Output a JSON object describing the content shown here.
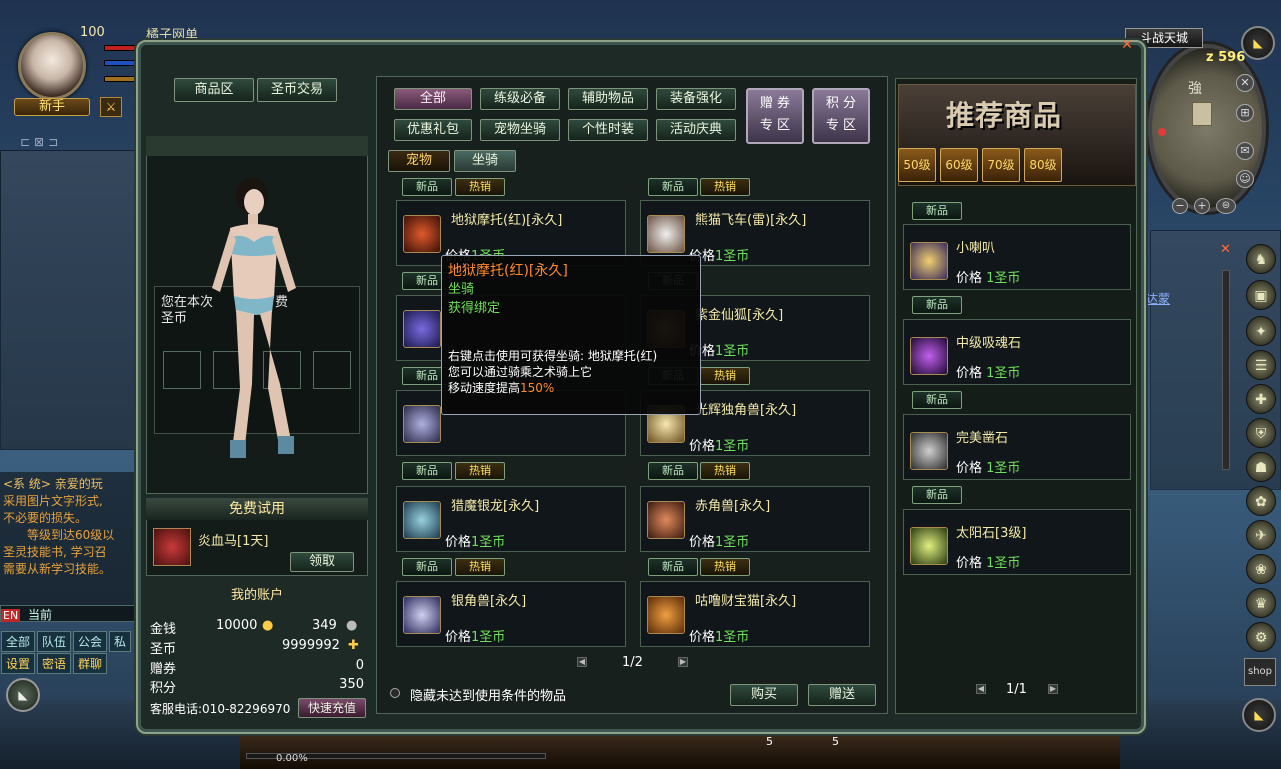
{
  "player": {
    "level": "100",
    "rank": "新手",
    "guild": "橘子网单"
  },
  "minimap": {
    "map_name": "斗战天城",
    "z_label": "z",
    "z_value": "596",
    "strong_char": "強"
  },
  "chat": {
    "lines": [
      {
        "t": "<系 统> 亲爱的玩",
        "c": "sys"
      },
      {
        "t": "采用图片文字形式,",
        "c": "msg"
      },
      {
        "t": "不必要的损失。",
        "c": "msg"
      },
      {
        "t": "等级到达60级以",
        "c": "msg"
      },
      {
        "t": "圣灵技能书, 学习召",
        "c": "msg"
      },
      {
        "t": "需要从新学习技能。",
        "c": "msg"
      }
    ],
    "input_prefix": "EN",
    "input_channel": "当前",
    "tabs_row1": [
      "全部",
      "队伍",
      "公会",
      "私"
    ],
    "tabs_row2": [
      "设置",
      "密语",
      "群聊"
    ]
  },
  "shop": {
    "top_tabs": [
      "商品区",
      "圣币交易"
    ],
    "preview_text_1": "您在本次",
    "preview_text_2": "费",
    "preview_text_3": "圣币",
    "free_trial": {
      "title": "免费试用",
      "item": "炎血马[1天]",
      "button": "领取"
    },
    "account": {
      "title": "我的账户",
      "gold_label": "金钱",
      "gold_value": "10000",
      "silver_value": "349",
      "coin_label": "圣币",
      "coin_value": "9999992",
      "voucher_label": "赠券",
      "voucher_value": "0",
      "points_label": "积分",
      "points_value": "350",
      "phone": "客服电话:010-82296970",
      "recharge_button": "快速充值"
    },
    "categories_row1": [
      "全部",
      "练级必备",
      "辅助物品",
      "装备强化"
    ],
    "categories_row2": [
      "优惠礼包",
      "宠物坐骑",
      "个性时装",
      "活动庆典"
    ],
    "zone_buttons": [
      {
        "l1": "赠 券",
        "l2": "专 区"
      },
      {
        "l1": "积 分",
        "l2": "专 区"
      }
    ],
    "sub_tabs": [
      "宠物",
      "坐骑"
    ],
    "badge_new": "新品",
    "badge_hot": "热销",
    "price_label": "价格",
    "price_unit": "1圣币",
    "items_left": [
      "地狱摩托(红)[永久]",
      "",
      "",
      "猎魔银龙[永久]",
      "银角兽[永久]"
    ],
    "items_right": [
      "熊猫飞车(雷)[永久]",
      "紫金仙狐[永久]",
      "光辉独角兽[永久]",
      "赤角兽[永久]",
      "咕噜财宝猫[永久]"
    ],
    "page": "1/2",
    "hide_unusable": "隐藏未达到使用条件的物品",
    "buy_button": "购买",
    "gift_button": "赠送",
    "recommend": {
      "title": "推荐商品",
      "levels": [
        "50级",
        "60级",
        "70级",
        "80级"
      ],
      "items": [
        "小喇叭",
        "中级吸魂石",
        "完美凿石",
        "太阳石[3级]"
      ],
      "page": "1/1"
    }
  },
  "tooltip": {
    "title": "地狱摩托(红)[永久]",
    "type": "坐骑",
    "bind": "获得绑定",
    "desc1": "右键点击使用可获得坐骑: 地狱摩托(红)",
    "desc2": "您可以通过骑乘之术骑上它",
    "desc3_prefix": "移动速度提高",
    "desc3_value": "150%"
  },
  "hotbar": {
    "exp": "0.00%",
    "slot_count_a": "5",
    "slot_count_b": "5"
  },
  "right_side": {
    "npc_label": "达蒙"
  }
}
